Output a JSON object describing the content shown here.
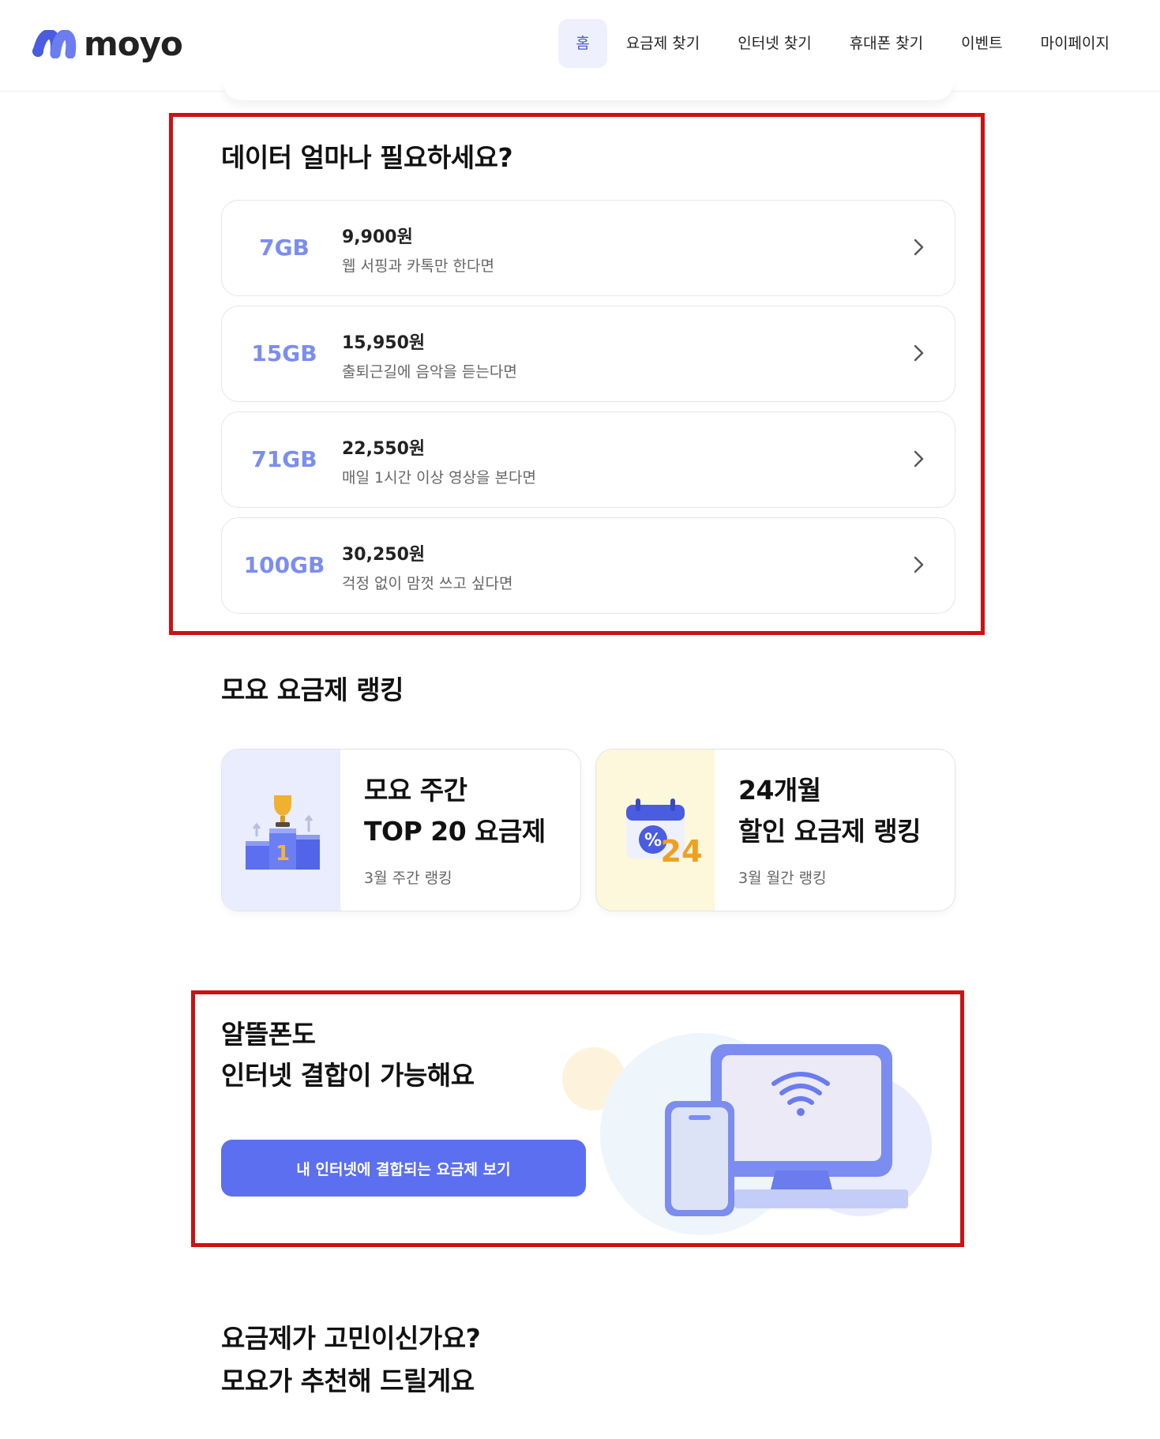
{
  "brand": {
    "name": "moyo",
    "color": "#5b6ff0"
  },
  "nav": {
    "items": [
      {
        "label": "홈",
        "active": true
      },
      {
        "label": "요금제 찾기",
        "active": false
      },
      {
        "label": "인터넷 찾기",
        "active": false
      },
      {
        "label": "휴대폰 찾기",
        "active": false
      },
      {
        "label": "이벤트",
        "active": false
      },
      {
        "label": "마이페이지",
        "active": false
      }
    ]
  },
  "data_section": {
    "title": "데이터 얼마나 필요하세요?",
    "plans": [
      {
        "data": "7GB",
        "price": "9,900원",
        "desc": "웹 서핑과 카톡만 한다면"
      },
      {
        "data": "15GB",
        "price": "15,950원",
        "desc": "출퇴근길에 음악을 듣는다면"
      },
      {
        "data": "71GB",
        "price": "22,550원",
        "desc": "매일 1시간 이상 영상을 본다면"
      },
      {
        "data": "100GB",
        "price": "30,250원",
        "desc": "걱정 없이 맘껏 쓰고 싶다면"
      }
    ]
  },
  "ranking_section": {
    "title": "모요 요금제 랭킹",
    "cards": [
      {
        "title": "모요 주간\nTOP 20 요금제",
        "subtitle": "3월 주간 랭킹",
        "icon": "trophy-podium-icon",
        "bg": "#e9edfd"
      },
      {
        "title": "24개월\n할인 요금제 랭킹",
        "subtitle": "3월 월간 랭킹",
        "icon": "discount-calendar-icon",
        "bg": "#fdf7dc"
      }
    ]
  },
  "combo_section": {
    "title_line1": "알뜰폰도",
    "title_line2": "인터넷 결합이 가능해요",
    "button_label": "내 인터넷에 결합되는 요금제 보기",
    "icon": "monitor-phone-wifi-icon"
  },
  "recommend_section": {
    "title_line1": "요금제가 고민이신가요?",
    "title_line2": "모요가 추천해 드릴게요"
  },
  "colors": {
    "accent": "#5b6ff0",
    "gb_text": "#7b8df0",
    "highlight_border": "#cc1111"
  }
}
